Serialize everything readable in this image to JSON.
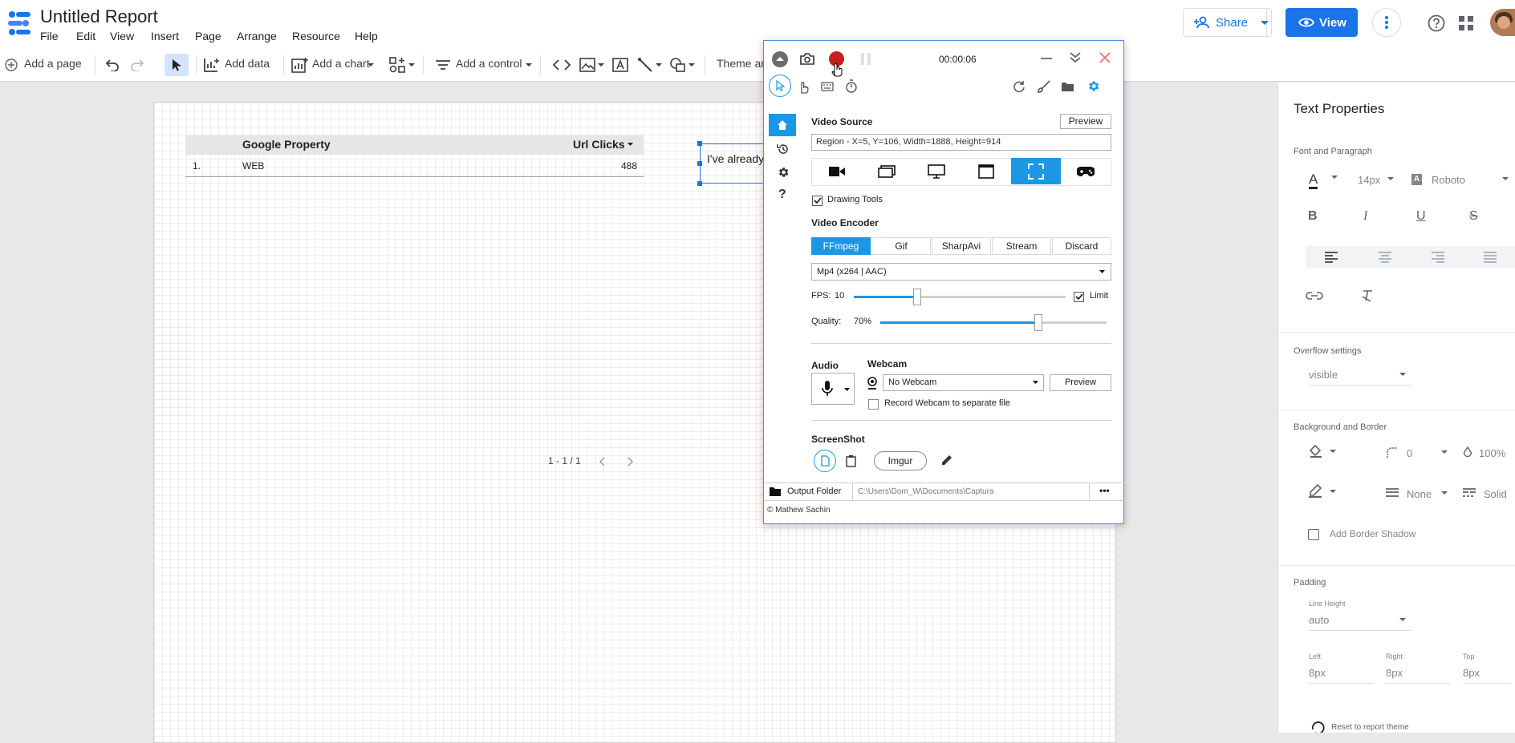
{
  "app": {
    "title": "Untitled Report",
    "menus": [
      "File",
      "Edit",
      "View",
      "Insert",
      "Page",
      "Arrange",
      "Resource",
      "Help"
    ],
    "share_label": "Share",
    "view_label": "View"
  },
  "toolbar": {
    "add_page": "Add a page",
    "add_data": "Add data",
    "add_chart": "Add a chart",
    "add_control": "Add a control",
    "theme": "Theme ar"
  },
  "table": {
    "headers": [
      "Google Property",
      "Url Clicks"
    ],
    "rows": [
      {
        "num": "1.",
        "property": "WEB",
        "clicks": "488"
      }
    ],
    "pagination": "1 - 1 / 1"
  },
  "textbox": {
    "text": "I've already"
  },
  "panel": {
    "title": "Text Properties",
    "font_section": "Font and Paragraph",
    "font_size": "14px",
    "font_family": "Roboto",
    "overflow_section": "Overflow settings",
    "overflow_value": "visible",
    "bg_section": "Background and Border",
    "border_radius": "0",
    "opacity": "100%",
    "border_weight": "None",
    "border_style": "Solid",
    "shadow_label": "Add Border Shadow",
    "padding_section": "Padding",
    "line_height_label": "Line Height",
    "line_height": "auto",
    "left_label": "Left",
    "left_val": "8px",
    "right_label": "Right",
    "right_val": "8px",
    "top_label": "Top",
    "top_val": "8px",
    "reset_label": "Reset to report theme"
  },
  "captura": {
    "timer": "00:00:06",
    "video_source_label": "Video Source",
    "preview": "Preview",
    "region_text": "Region  -  X=5, Y=106, Width=1888, Height=914",
    "drawing_tools": "Drawing Tools",
    "video_encoder_label": "Video Encoder",
    "encoders": [
      "FFmpeg",
      "Gif",
      "SharpAvi",
      "Stream",
      "Discard"
    ],
    "encoder_selected": "FFmpeg",
    "format": "Mp4 (x264 | AAC)",
    "fps_label": "FPS:",
    "fps": "10",
    "fps_level": 0.3,
    "limit_label": "Limit",
    "quality_label": "Quality:",
    "quality": "70%",
    "quality_level": 0.7,
    "audio_label": "Audio",
    "webcam_label": "Webcam",
    "webcam_value": "No Webcam",
    "webcam_preview": "Preview",
    "record_webcam": "Record Webcam to separate file",
    "screenshot_label": "ScreenShot",
    "imgur": "Imgur",
    "output_folder_label": "Output Folder",
    "output_path": "C:\\Users\\Dom_W\\Documents\\Captura",
    "more": "•••",
    "credit": "© Mathew Sachin"
  },
  "colors": {
    "accent": "#1a73e8",
    "captura_blue": "#1c97e6",
    "record_red": "#c41e1e"
  }
}
